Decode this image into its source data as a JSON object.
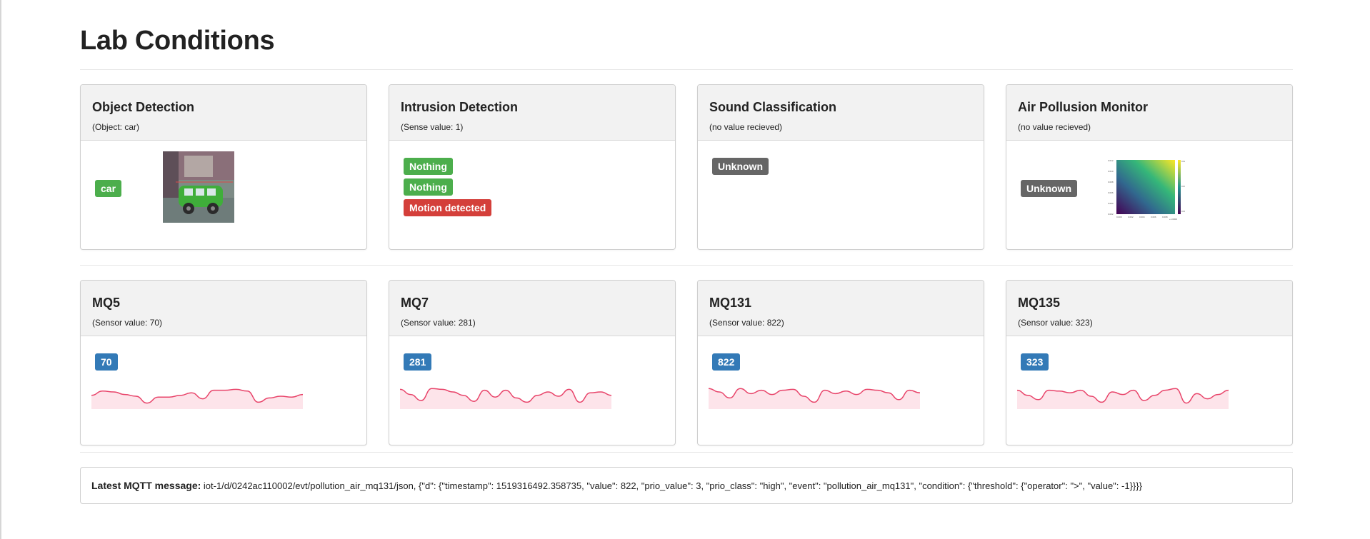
{
  "page": {
    "title": "Lab Conditions"
  },
  "row1": [
    {
      "title": "Object Detection",
      "subtitle": "(Object: car)",
      "badge": "car",
      "badge_color": "#4cae4c"
    },
    {
      "title": "Intrusion Detection",
      "subtitle": "(Sense value: 1)",
      "events": [
        "Nothing",
        "Nothing",
        "Motion detected"
      ]
    },
    {
      "title": "Sound Classification",
      "subtitle": "(no value recieved)",
      "badge": "Unknown"
    },
    {
      "title": "Air Pollusion Monitor",
      "subtitle": "(no value recieved)",
      "badge": "Unknown"
    }
  ],
  "row2": [
    {
      "title": "MQ5",
      "subtitle": "(Sensor value: 70)",
      "badge": "70",
      "spark": [
        0.55,
        0.8,
        0.75,
        0.6,
        0.5,
        0.1,
        0.45,
        0.45,
        0.55,
        0.7,
        0.35,
        0.85,
        0.85,
        0.9,
        0.8,
        0.15,
        0.4,
        0.5,
        0.45,
        0.6
      ]
    },
    {
      "title": "MQ7",
      "subtitle": "(Sensor value: 281)",
      "badge": "281",
      "spark": [
        0.9,
        0.6,
        0.25,
        0.95,
        0.9,
        0.75,
        0.55,
        0.2,
        0.85,
        0.45,
        0.85,
        0.4,
        0.15,
        0.55,
        0.75,
        0.5,
        0.9,
        0.15,
        0.7,
        0.75,
        0.55
      ]
    },
    {
      "title": "MQ131",
      "subtitle": "(Sensor value: 822)",
      "badge": "822",
      "spark": [
        0.95,
        0.75,
        0.4,
        0.95,
        0.65,
        0.85,
        0.6,
        0.85,
        0.9,
        0.5,
        0.15,
        0.85,
        0.65,
        0.8,
        0.6,
        0.9,
        0.85,
        0.7,
        0.3,
        0.85,
        0.7
      ]
    },
    {
      "title": "MQ135",
      "subtitle": "(Sensor value: 323)",
      "badge": "323",
      "spark": [
        0.85,
        0.55,
        0.3,
        0.85,
        0.8,
        0.7,
        0.85,
        0.5,
        0.15,
        0.75,
        0.6,
        0.85,
        0.25,
        0.55,
        0.85,
        0.95,
        0.1,
        0.65,
        0.35,
        0.6,
        0.85
      ]
    }
  ],
  "mqtt": {
    "label": "Latest MQTT message:",
    "message": "iot-1/d/0242ac110002/evt/pollution_air_mq131/json, {\"d\": {\"timestamp\": 1519316492.358735, \"value\": 822, \"prio_value\": 3, \"prio_class\": \"high\", \"event\": \"pollution_air_mq131\", \"condition\": {\"threshold\": {\"operator\": \">\", \"value\": -1}}}}"
  },
  "colors": {
    "spark_line": "#e8446a",
    "spark_fill": "#fde4ea",
    "heat_low": "#440154",
    "heat_high": "#fde725"
  }
}
